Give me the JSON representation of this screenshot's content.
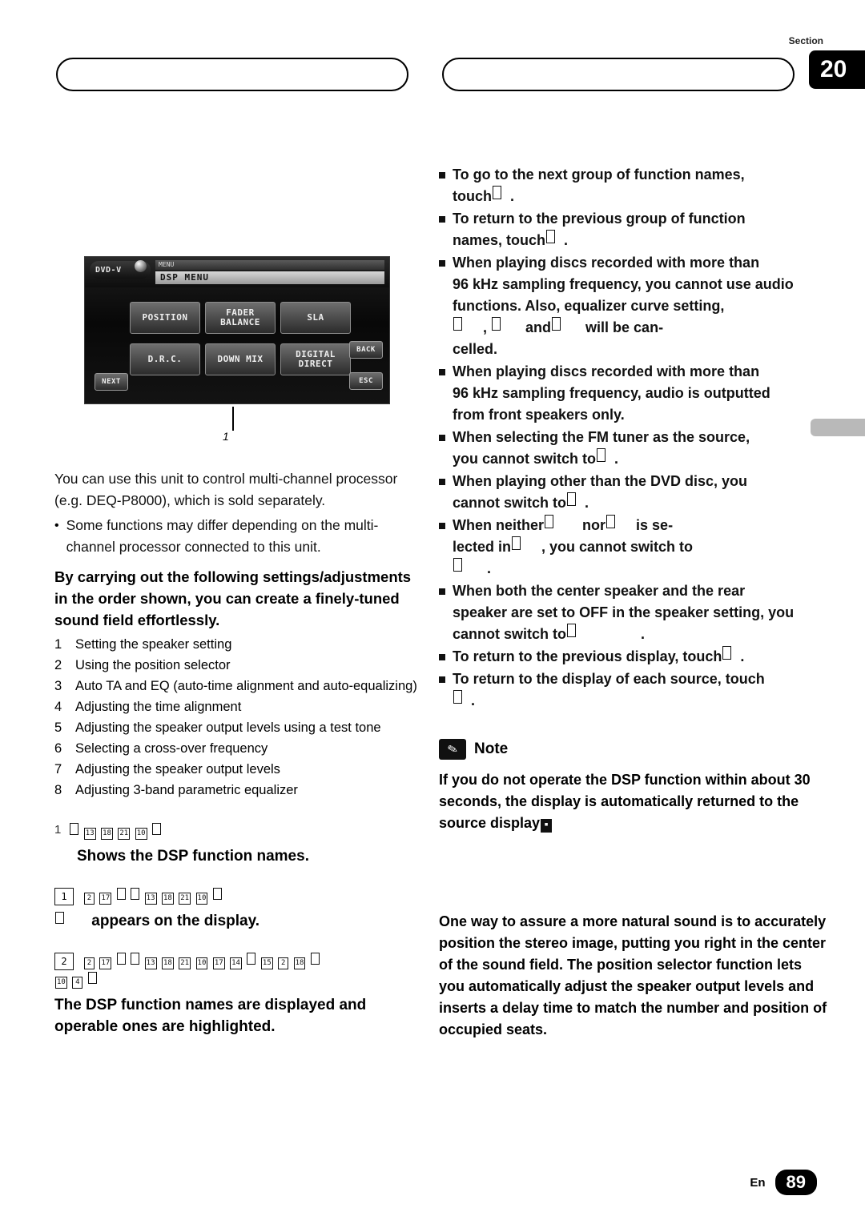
{
  "header": {
    "section_word": "Section",
    "section_number": "20"
  },
  "illustration": {
    "badge": "DVD-V",
    "menu_label": "MENU",
    "title_bar": "DSP MENU",
    "buttons": [
      {
        "id": "position",
        "label": "POSITION"
      },
      {
        "id": "fader-balance",
        "label": "FADER\nBALANCE"
      },
      {
        "id": "sla",
        "label": "SLA"
      },
      {
        "id": "drc",
        "label": "D.R.C."
      },
      {
        "id": "down-mix",
        "label": "DOWN MIX"
      },
      {
        "id": "digital-direct",
        "label": "DIGITAL\nDIRECT"
      }
    ],
    "next_label": "NEXT",
    "back_label": "BACK",
    "esc_label": "ESC",
    "callout_number": "1"
  },
  "left_column": {
    "intro": "You can use this unit to control multi-channel processor (e.g. DEQ-P8000), which is sold separately.",
    "bullet1": "Some functions may differ depending on the multi-channel processor connected to this unit.",
    "bold_heading": "By carrying out the following settings/adjustments in the order shown, you can create a finely-tuned sound field effortlessly.",
    "steps": [
      {
        "num": "1",
        "text": "Setting the speaker setting"
      },
      {
        "num": "2",
        "text": "Using the position selector"
      },
      {
        "num": "3",
        "text": "Auto TA and EQ (auto-time alignment and auto-equalizing)"
      },
      {
        "num": "4",
        "text": "Adjusting the time alignment"
      },
      {
        "num": "5",
        "text": "Adjusting the speaker output levels using a test tone"
      },
      {
        "num": "6",
        "text": "Selecting a cross-over frequency"
      },
      {
        "num": "7",
        "text": "Adjusting the speaker output levels"
      },
      {
        "num": "8",
        "text": "Adjusting 3-band parametric equalizer"
      }
    ],
    "caption_num": "1",
    "caption_glyphs": [
      "13",
      "18",
      "21",
      "10",
      ""
    ],
    "caption_text": "Shows the DSP function names.",
    "step1": {
      "num": "1",
      "glyphs": [
        "2",
        "17",
        "",
        "13",
        "18",
        "21",
        "10",
        ""
      ],
      "result_glyph": "",
      "result_text": "appears on the display."
    },
    "step2": {
      "num": "2",
      "glyphs_line1": [
        "2",
        "17",
        "",
        "13",
        "18",
        "21",
        "10",
        "17",
        "14",
        "",
        "15",
        "2",
        "18",
        ""
      ],
      "glyphs_line2": [
        "10",
        "4",
        ""
      ],
      "result_text": "The DSP function names are displayed and operable ones are highlighted."
    }
  },
  "right_column": {
    "bullets": [
      {
        "text": "To go to the next group of function names, touch",
        "glyph_inline": "",
        "tail": "."
      },
      {
        "text": "To return to the previous group of function names, touch",
        "glyph_inline": "",
        "tail": "."
      },
      {
        "text": "When playing discs recorded with more than 96 kHz sampling frequency, you cannot use audio functions. Also, equalizer curve setting,",
        "glyph_inline": "",
        "tail": ", and will be cancelled."
      },
      {
        "text": "When playing discs recorded with more than 96 kHz sampling frequency, audio is outputted from front speakers only.",
        "glyph_inline": "",
        "tail": ""
      },
      {
        "text": "When selecting the FM tuner as the source, you cannot switch to",
        "glyph_inline": "",
        "tail": "."
      },
      {
        "text": "When playing other than the DVD disc, you cannot switch to",
        "glyph_inline": "",
        "tail": "."
      },
      {
        "text": "When neither",
        "glyph_inline": "",
        "tail": "nor is selected in , you cannot switch to ."
      },
      {
        "text": "When both the center speaker and the rear speaker are set to OFF in the speaker setting, you cannot switch to",
        "glyph_inline": "",
        "tail": "."
      },
      {
        "text": "To return to the previous display, touch",
        "glyph_inline": "",
        "tail": "."
      },
      {
        "text": "To return to the display of each source, touch",
        "glyph_inline": "",
        "tail": "."
      }
    ],
    "bullet_lines": [
      "To go to the next group of function names,",
      "touch ▯ .",
      "To return to the previous group of function",
      "names, touch ▯ .",
      "When playing discs recorded with more than",
      "96 kHz sampling frequency, you cannot use audio",
      "functions. Also, equalizer curve setting,",
      "▯ , ▯ and ▯ will be can-",
      "celled.",
      "When playing discs recorded with more than",
      "96 kHz sampling frequency, audio is outputted",
      "from front speakers only.",
      "When selecting the FM tuner as the source,",
      "you cannot switch to ▯ .",
      "When playing other than the DVD disc, you",
      "cannot switch to ▯ .",
      "When neither ▯ nor ▯ is se-",
      "lected in ▯ , you cannot switch to",
      "▯ .",
      "When both the center speaker and the rear",
      "speaker are set to OFF in the speaker setting, you",
      "cannot switch to ▯ .",
      "To return to the previous display, touch ▯ .",
      "To return to the display of each source, touch",
      "▯ ."
    ],
    "note": {
      "title": "Note",
      "body": "If you do not operate the DSP function within about 30 seconds, the display is automatically returned to the source display"
    },
    "closing": "One way to assure a more natural sound is to accurately position the stereo image, putting you right in the center of the sound field. The position selector function lets you automatically adjust the speaker output levels and inserts a delay time to match the number and position of occupied seats."
  },
  "footer": {
    "lang": "En",
    "page": "89"
  }
}
